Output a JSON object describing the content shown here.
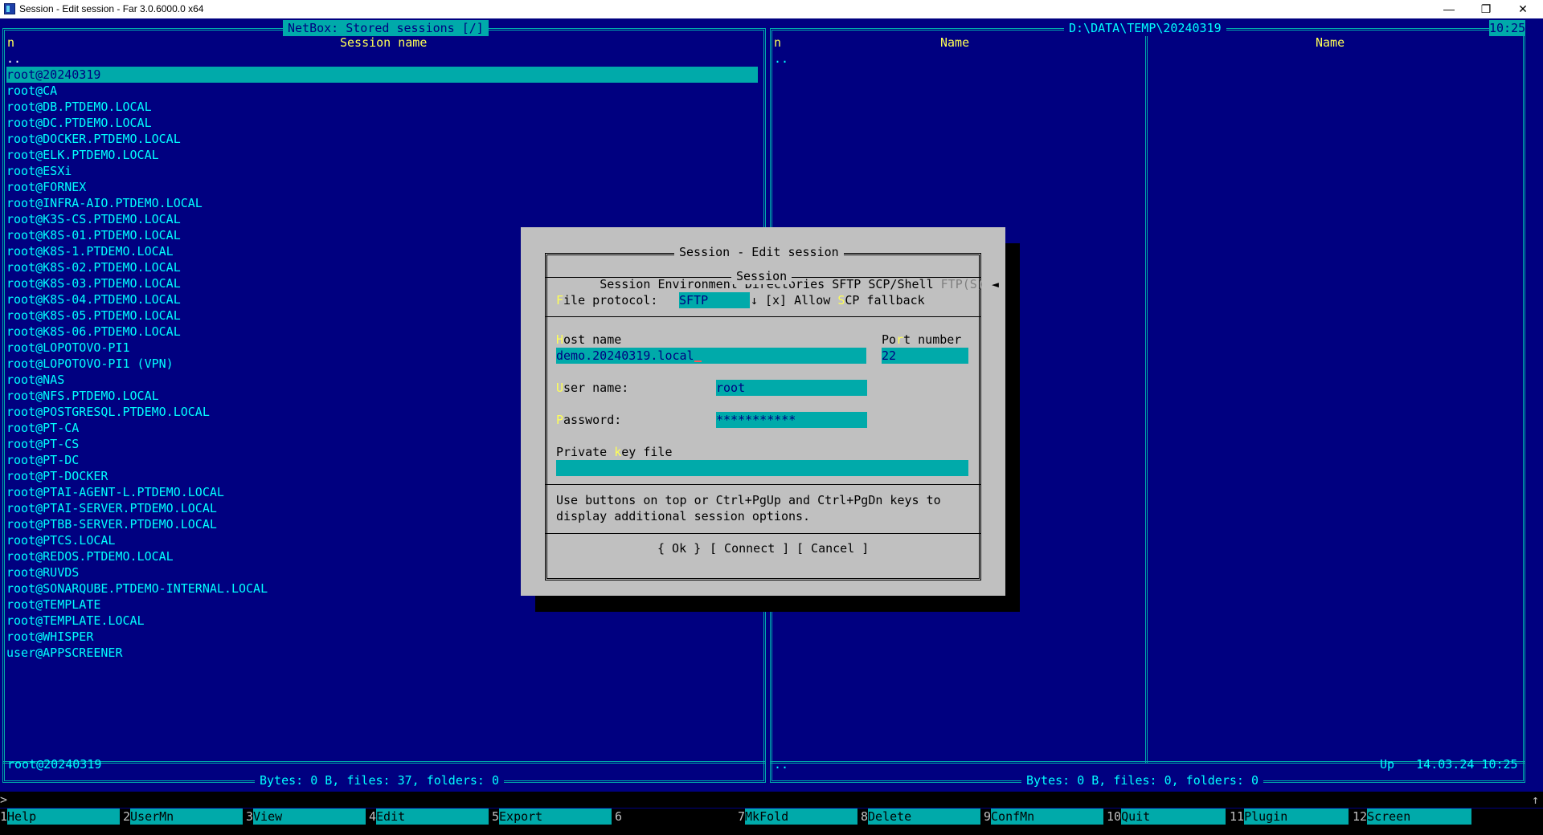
{
  "window": {
    "title": "Session - Edit session - Far 3.0.6000.0 x64",
    "minimize": "—",
    "restore": "❐",
    "close": "✕"
  },
  "clock": "10:25",
  "left_panel": {
    "title": "NetBox: Stored sessions [/]",
    "col_n": "n",
    "col_name": "Session name",
    "parent": "..",
    "items": [
      "root@20240319",
      "root@CA",
      "root@DB.PTDEMO.LOCAL",
      "root@DC.PTDEMO.LOCAL",
      "root@DOCKER.PTDEMO.LOCAL",
      "root@ELK.PTDEMO.LOCAL",
      "root@ESXi",
      "root@FORNEX",
      "root@INFRA-AIO.PTDEMO.LOCAL",
      "root@K3S-CS.PTDEMO.LOCAL",
      "root@K8S-01.PTDEMO.LOCAL",
      "root@K8S-1.PTDEMO.LOCAL",
      "root@K8S-02.PTDEMO.LOCAL",
      "root@K8S-03.PTDEMO.LOCAL",
      "root@K8S-04.PTDEMO.LOCAL",
      "root@K8S-05.PTDEMO.LOCAL",
      "root@K8S-06.PTDEMO.LOCAL",
      "root@LOPOTOVO-PI1",
      "root@LOPOTOVO-PI1 (VPN)",
      "root@NAS",
      "root@NFS.PTDEMO.LOCAL",
      "root@POSTGRESQL.PTDEMO.LOCAL",
      "root@PT-CA",
      "root@PT-CS",
      "root@PT-DC",
      "root@PT-DOCKER",
      "root@PTAI-AGENT-L.PTDEMO.LOCAL",
      "root@PTAI-SERVER.PTDEMO.LOCAL",
      "root@PTBB-SERVER.PTDEMO.LOCAL",
      "root@PTCS.LOCAL",
      "root@REDOS.PTDEMO.LOCAL",
      "root@RUVDS",
      "root@SONARQUBE.PTDEMO-INTERNAL.LOCAL",
      "root@TEMPLATE",
      "root@TEMPLATE.LOCAL",
      "root@WHISPER",
      "user@APPSCREENER"
    ],
    "status_name": "root@20240319",
    "info": "Bytes: 0 B, files: 37, folders: 0"
  },
  "right_panel": {
    "title": "D:\\DATA\\TEMP\\20240319",
    "col_n": "n",
    "col_name1": "Name",
    "col_name2": "Name",
    "parent": "..",
    "status_name": "..",
    "status_right": "Up   14.03.24 10:25",
    "info": "Bytes: 0 B, files: 0, folders: 0"
  },
  "dialog": {
    "title": "Session - Edit session",
    "tabs": {
      "session": "Session",
      "environment": "Environment",
      "directories": "Directories",
      "sftp": "SFTP",
      "scp_shell": "SCP/Shell",
      "ftps": "FTP(S)",
      "arrows": "◄ ►"
    },
    "section": "Session",
    "file_protocol": {
      "hot": "F",
      "rest": "ile protocol:",
      "value": "SFTP",
      "arrow": "↓"
    },
    "scp_fallback": {
      "check": "[x] Allow ",
      "hot": "S",
      "rest": "CP fallback"
    },
    "host": {
      "hot": "H",
      "rest": "ost name",
      "value": "demo.20240319.local"
    },
    "port": {
      "pre": "Po",
      "hot": "r",
      "rest": "t number",
      "value": "22"
    },
    "user": {
      "hot": "U",
      "rest": "ser name:",
      "value": "root"
    },
    "password": {
      "hot": "P",
      "rest": "assword:",
      "value": "***********"
    },
    "private_key": {
      "pre": "Private ",
      "hot": "k",
      "rest": "ey file",
      "value": ""
    },
    "hint_line1": "Use buttons on top or Ctrl+PgUp and Ctrl+PgDn keys to",
    "hint_line2": "display additional session options.",
    "btn_ok": "{ Ok }",
    "btn_connect": "[ Connect ]",
    "btn_cancel": "[ Cancel ]"
  },
  "command_prompt": ">",
  "scroll_marker": "↑",
  "keybar": [
    {
      "num": "1",
      "label": "Help"
    },
    {
      "num": "2",
      "label": "UserMn"
    },
    {
      "num": "3",
      "label": "View"
    },
    {
      "num": "4",
      "label": "Edit"
    },
    {
      "num": "5",
      "label": "Export"
    },
    {
      "num": "6",
      "label": ""
    },
    {
      "num": "7",
      "label": "MkFold"
    },
    {
      "num": "8",
      "label": "Delete"
    },
    {
      "num": "9",
      "label": "ConfMn"
    },
    {
      "num": "10",
      "label": "Quit"
    },
    {
      "num": "11",
      "label": "Plugin"
    },
    {
      "num": "12",
      "label": "Screen"
    }
  ]
}
